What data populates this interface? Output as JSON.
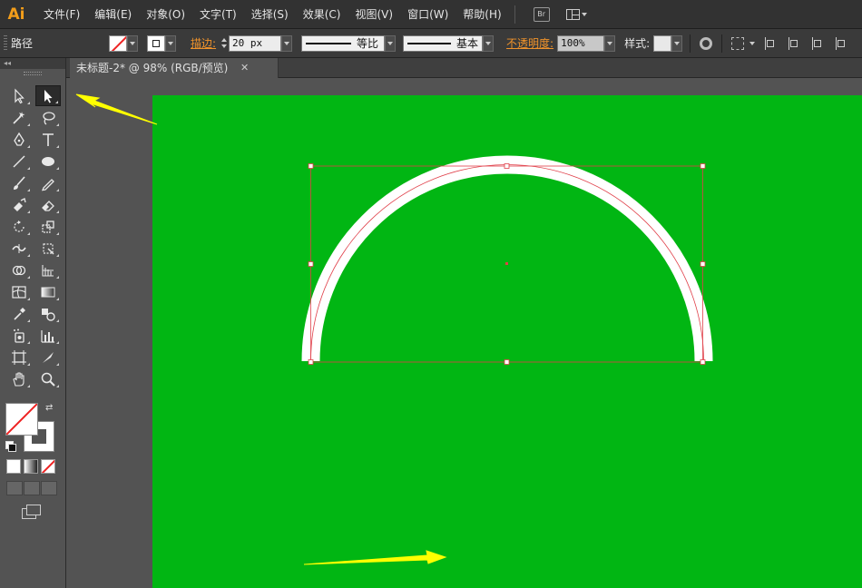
{
  "app": {
    "logo": "Ai"
  },
  "menu": {
    "items": [
      "文件(F)",
      "编辑(E)",
      "对象(O)",
      "文字(T)",
      "选择(S)",
      "效果(C)",
      "视图(V)",
      "窗口(W)",
      "帮助(H)"
    ],
    "bridge_label": "Br"
  },
  "control_bar": {
    "selection_label": "路径",
    "stroke_label": "描边:",
    "stroke_value": "20 px",
    "profile_label": "等比",
    "brush_label": "基本",
    "opacity_label": "不透明度:",
    "opacity_value": "100%",
    "style_label": "样式:"
  },
  "tools_panel": {
    "collapse_glyph": "◂◂"
  },
  "document": {
    "tab_title": "未标题-2* @ 98% (RGB/预览)",
    "tab_close": "✕"
  },
  "artwork": {
    "shape": "semicircle-arc",
    "stroke_color": "#ffffff",
    "artboard_color": "#01b613",
    "selection_color": "#e0404a",
    "annotation_color": "#ffff00"
  },
  "colors": {
    "menubar_bg": "#323232",
    "controlbar_bg": "#3a3a3a",
    "panel_bg": "#535353",
    "accent_orange": "#f0932b",
    "logo_orange": "#f29d1a"
  }
}
